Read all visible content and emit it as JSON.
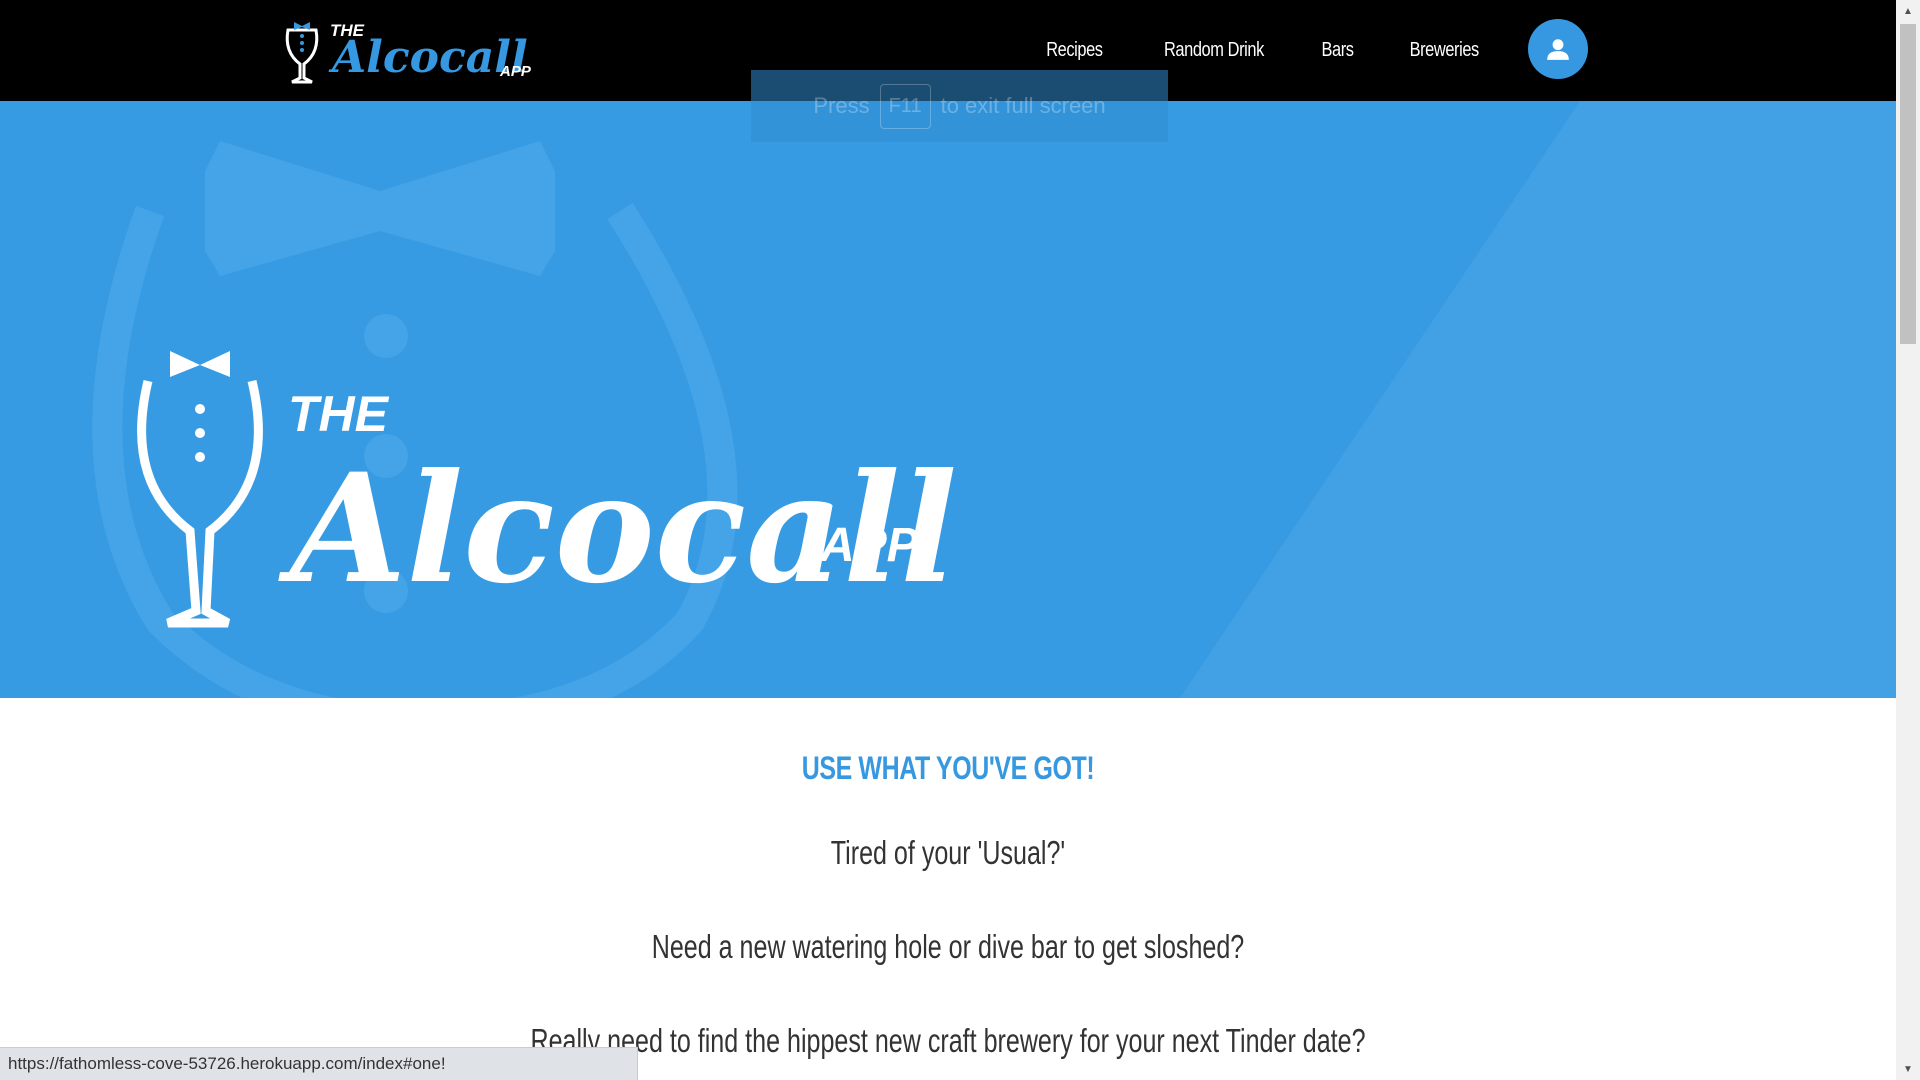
{
  "app": {
    "logo_text_the": "THE",
    "logo_text_name": "Alcocall",
    "logo_text_app": "APP"
  },
  "nav": {
    "items": [
      {
        "label": "Recipes"
      },
      {
        "label": "Random Drink"
      },
      {
        "label": "Bars"
      },
      {
        "label": "Breweries"
      }
    ],
    "account_icon": "user-icon"
  },
  "fullscreen_notice": {
    "prefix": "Press",
    "key": "F11",
    "suffix": "to exit full screen"
  },
  "section": {
    "heading": "USE WHAT YOU'VE GOT!",
    "paragraphs": [
      "Tired of your 'Usual?'",
      "Need a new watering hole or dive bar to get sloshed?",
      "Really need to find the hippest new craft brewery for your next Tinder date?"
    ]
  },
  "status_bar": {
    "url": "https://fathomless-cove-53726.herokuapp.com/index#one!"
  },
  "colors": {
    "navbar": "#000000",
    "hero": "#379be3",
    "accent": "#3598e0",
    "body_text": "#333333"
  }
}
